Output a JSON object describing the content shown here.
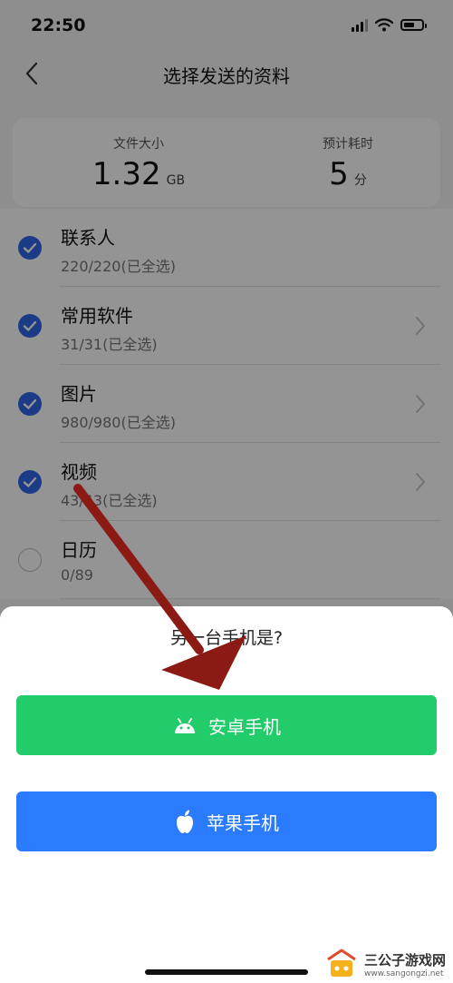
{
  "status_bar": {
    "time": "22:50",
    "battery_level": 0.6
  },
  "header": {
    "title": "选择发送的资料"
  },
  "summary": {
    "size_label": "文件大小",
    "size_value": "1.32",
    "size_unit": "GB",
    "time_label": "预计耗时",
    "time_value": "5",
    "time_unit": "分"
  },
  "items": [
    {
      "title": "联系人",
      "subtitle": "220/220(已全选)",
      "checked": true,
      "has_chevron": false
    },
    {
      "title": "常用软件",
      "subtitle": "31/31(已全选)",
      "checked": true,
      "has_chevron": true
    },
    {
      "title": "图片",
      "subtitle": "980/980(已全选)",
      "checked": true,
      "has_chevron": true
    },
    {
      "title": "视频",
      "subtitle": "43/43(已全选)",
      "checked": true,
      "has_chevron": true
    },
    {
      "title": "日历",
      "subtitle": "0/89",
      "checked": false,
      "has_chevron": false
    }
  ],
  "sheet": {
    "question": "另一台手机是?",
    "android_label": "安卓手机",
    "apple_label": "苹果手机"
  },
  "watermark": {
    "name": "三公子游戏网",
    "url": "www.sangongzi.net"
  },
  "colors": {
    "accent": "#2f67e8",
    "android": "#23cc6a",
    "apple": "#2a7bff",
    "arrow": "#8b1a14"
  }
}
